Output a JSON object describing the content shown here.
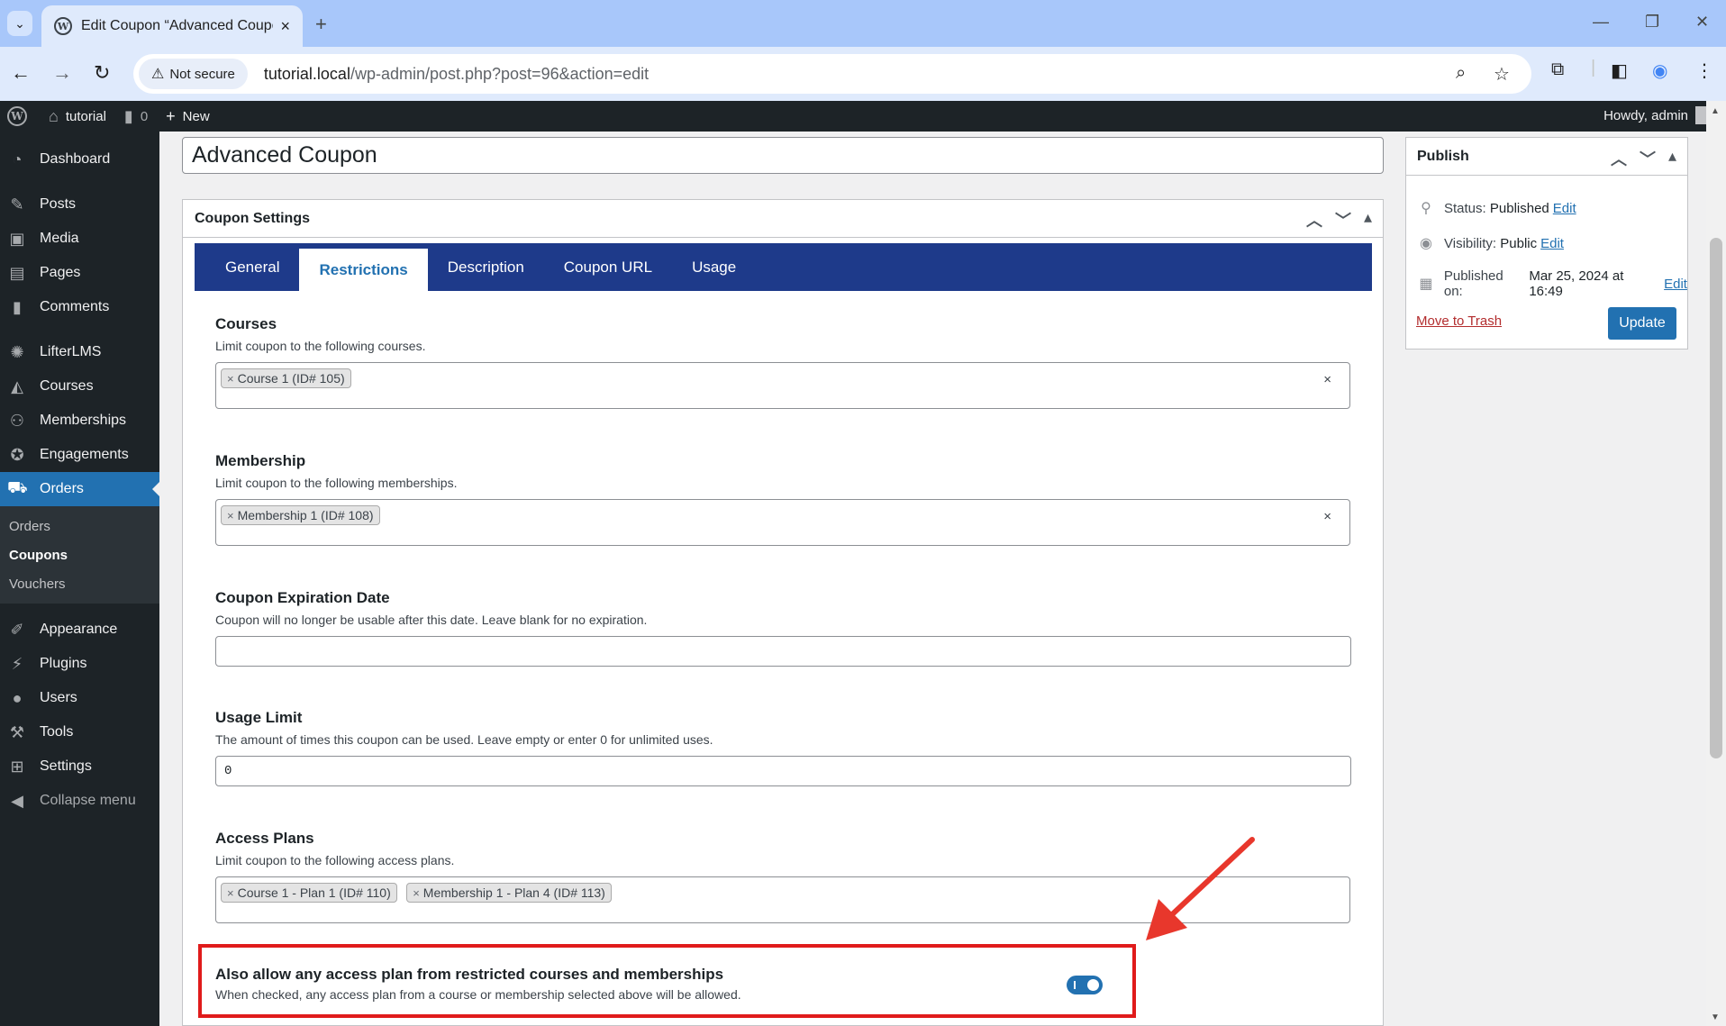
{
  "browser": {
    "tab_title": "Edit Coupon “Advanced Coupo…",
    "security_label": "Not secure",
    "url_host": "tutorial.local",
    "url_path": "/wp-admin/post.php?post=96&action=edit"
  },
  "adminbar": {
    "site_name": "tutorial",
    "comments_count": "0",
    "new_label": "New",
    "howdy": "Howdy, admin"
  },
  "sidebar": {
    "items": [
      {
        "label": "Dashboard",
        "icon": "dashboard-icon"
      },
      {
        "label": "Posts",
        "icon": "pin-icon"
      },
      {
        "label": "Media",
        "icon": "media-icon"
      },
      {
        "label": "Pages",
        "icon": "page-icon"
      },
      {
        "label": "Comments",
        "icon": "comment-icon"
      },
      {
        "label": "LifterLMS",
        "icon": "lifterlms-icon"
      },
      {
        "label": "Courses",
        "icon": "graduation-cap-icon"
      },
      {
        "label": "Memberships",
        "icon": "groups-icon"
      },
      {
        "label": "Engagements",
        "icon": "award-icon"
      },
      {
        "label": "Orders",
        "icon": "cart-icon"
      }
    ],
    "submenu": [
      "Orders",
      "Coupons",
      "Vouchers"
    ],
    "items2": [
      {
        "label": "Appearance",
        "icon": "brush-icon"
      },
      {
        "label": "Plugins",
        "icon": "plugin-icon"
      },
      {
        "label": "Users",
        "icon": "user-icon"
      },
      {
        "label": "Tools",
        "icon": "wrench-icon"
      },
      {
        "label": "Settings",
        "icon": "settings-icon"
      }
    ],
    "collapse": "Collapse menu"
  },
  "post": {
    "title": "Advanced Coupon"
  },
  "coupon_settings": {
    "header": "Coupon Settings",
    "tabs": [
      "General",
      "Restrictions",
      "Description",
      "Coupon URL",
      "Usage"
    ],
    "active_tab": "Restrictions",
    "courses": {
      "label": "Courses",
      "desc": "Limit coupon to the following courses.",
      "chips": [
        "Course 1 (ID# 105)"
      ]
    },
    "membership": {
      "label": "Membership",
      "desc": "Limit coupon to the following memberships.",
      "chips": [
        "Membership 1 (ID# 108)"
      ]
    },
    "expiration": {
      "label": "Coupon Expiration Date",
      "desc": "Coupon will no longer be usable after this date. Leave blank for no expiration.",
      "value": ""
    },
    "usage_limit": {
      "label": "Usage Limit",
      "desc": "The amount of times this coupon can be used. Leave empty or enter 0 for unlimited uses.",
      "value": "0"
    },
    "access_plans": {
      "label": "Access Plans",
      "desc": "Limit coupon to the following access plans.",
      "chips": [
        "Course 1 - Plan 1 (ID# 110)",
        "Membership 1 - Plan 4 (ID# 113)"
      ]
    },
    "allow_any": {
      "label": "Also allow any access plan from restricted courses and memberships",
      "desc": "When checked, any access plan from a course or membership selected above will be allowed.",
      "checked": true
    }
  },
  "publish": {
    "header": "Publish",
    "status_label": "Status:",
    "status_value": "Published",
    "visibility_label": "Visibility:",
    "visibility_value": "Public",
    "published_label": "Published on:",
    "published_value": "Mar 25, 2024 at 16:49",
    "edit": "Edit",
    "trash": "Move to Trash",
    "update": "Update"
  },
  "colors": {
    "admin_dark": "#1d2327",
    "wp_blue": "#2271b1",
    "tab_nav": "#1e3a8a",
    "highlight": "#e01b1b"
  }
}
